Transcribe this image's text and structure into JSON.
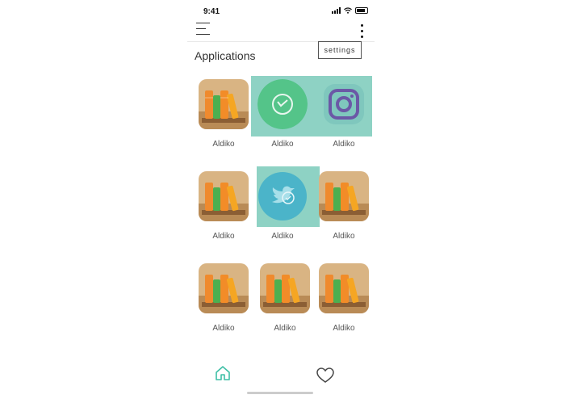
{
  "status_bar": {
    "time": "9:41"
  },
  "header": {
    "title": "Applications",
    "settings_label": "settings"
  },
  "apps": [
    {
      "label": "Aldiko",
      "icon": "book-shelf-icon"
    },
    {
      "label": "Aldiko",
      "icon": "whatsapp-icon",
      "selected": true
    },
    {
      "label": "Aldiko",
      "icon": "instagram-icon",
      "selected": true
    },
    {
      "label": "Aldiko",
      "icon": "book-shelf-icon"
    },
    {
      "label": "Aldiko",
      "icon": "twitter-icon",
      "selected": true
    },
    {
      "label": "Aldiko",
      "icon": "book-shelf-icon"
    },
    {
      "label": "Aldiko",
      "icon": "book-shelf-icon"
    },
    {
      "label": "Aldiko",
      "icon": "book-shelf-icon"
    },
    {
      "label": "Aldiko",
      "icon": "book-shelf-icon"
    }
  ],
  "bottom_nav": {
    "items": [
      "home-icon",
      "heart-icon"
    ],
    "active": "home-icon"
  },
  "colors": {
    "accent": "#3fbfa6",
    "selection": "#8ed2c4"
  }
}
